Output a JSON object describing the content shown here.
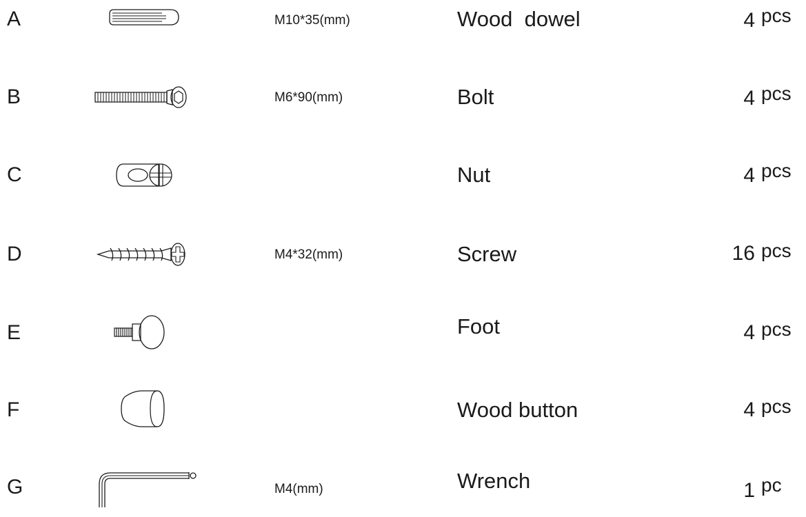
{
  "parts": [
    {
      "letter": "A",
      "icon": "wood-dowel-icon",
      "spec": "M10*35(mm)",
      "name": "Wood  dowel",
      "qty": "4",
      "unit": "pcs"
    },
    {
      "letter": "B",
      "icon": "bolt-icon",
      "spec": "M6*90(mm)",
      "name": "Bolt",
      "qty": "4",
      "unit": "pcs"
    },
    {
      "letter": "C",
      "icon": "barrel-nut-icon",
      "spec": "",
      "name": "Nut",
      "qty": "4",
      "unit": "pcs"
    },
    {
      "letter": "D",
      "icon": "wood-screw-icon",
      "spec": "M4*32(mm)",
      "name": "Screw",
      "qty": "16",
      "unit": "pcs"
    },
    {
      "letter": "E",
      "icon": "foot-icon",
      "spec": "",
      "name": "Foot",
      "qty": "4",
      "unit": "pcs"
    },
    {
      "letter": "F",
      "icon": "wood-button-icon",
      "spec": "",
      "name": "Wood button",
      "qty": "4",
      "unit": "pcs"
    },
    {
      "letter": "G",
      "icon": "allen-wrench-icon",
      "spec": "M4(mm)",
      "name": "Wrench",
      "qty": "1",
      "unit": "pc"
    }
  ],
  "colors": {
    "text": "#1a1a1a",
    "line": "#1a1a1a",
    "background": "#ffffff"
  }
}
